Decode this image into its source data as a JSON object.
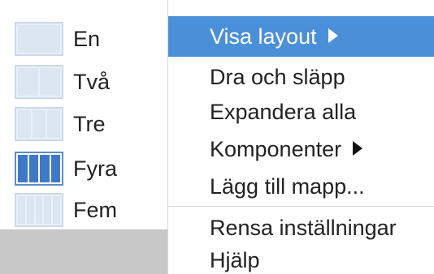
{
  "layout_menu": {
    "items": [
      {
        "label": "En",
        "columns": 1,
        "active": false
      },
      {
        "label": "Två",
        "columns": 2,
        "active": false
      },
      {
        "label": "Tre",
        "columns": 3,
        "active": false
      },
      {
        "label": "Fyra",
        "columns": 4,
        "active": true
      },
      {
        "label": "Fem",
        "columns": 5,
        "active": false
      }
    ]
  },
  "main_menu": {
    "items": [
      {
        "label": "Visa layout",
        "has_submenu": true,
        "highlighted": true
      },
      {
        "label": "Dra och släpp",
        "has_submenu": false,
        "highlighted": false
      },
      {
        "label": "Expandera alla",
        "has_submenu": false,
        "highlighted": false
      },
      {
        "label": "Komponenter",
        "has_submenu": true,
        "highlighted": false
      },
      {
        "label": "Lägg till mapp...",
        "has_submenu": false,
        "highlighted": false
      },
      {
        "label": "Rensa inställningar",
        "has_submenu": false,
        "highlighted": false
      },
      {
        "label": "Hjälp",
        "has_submenu": false,
        "highlighted": false
      }
    ]
  },
  "colors": {
    "highlight": "#4a90d9",
    "active_layout": "#3e79c8",
    "inactive_layout": "#dbe6f2",
    "footer": "#c8c8c8"
  }
}
